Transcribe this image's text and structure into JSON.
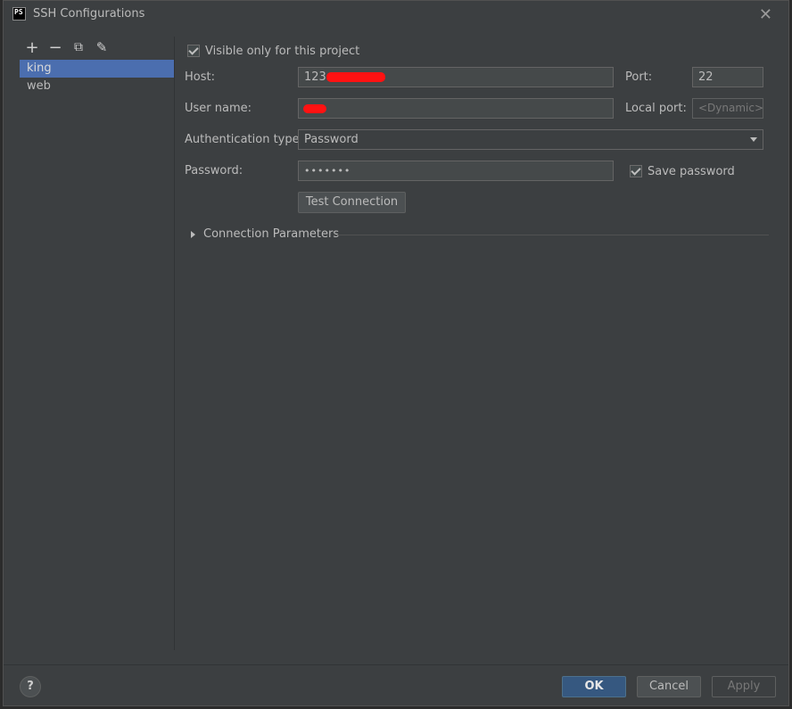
{
  "window": {
    "title": "SSH Configurations",
    "app_icon_text": "PS"
  },
  "toolbar": {
    "add": "+",
    "remove": "−",
    "copy": "⧉",
    "edit": "✎"
  },
  "configs": [
    {
      "label": "king",
      "selected": true
    },
    {
      "label": "web",
      "selected": false
    }
  ],
  "form": {
    "visible_only_label": "Visible only for this project",
    "visible_only_checked": true,
    "host_label": "Host:",
    "host_value": "123.",
    "port_label": "Port:",
    "port_value": "22",
    "username_label": "User name:",
    "username_value": "",
    "local_port_label": "Local port:",
    "local_port_placeholder": "<Dynamic>",
    "auth_label": "Authentication type:",
    "auth_value": "Password",
    "password_label": "Password:",
    "password_value": "•••••••",
    "save_password_label": "Save password",
    "save_password_checked": true,
    "test_connection_label": "Test Connection",
    "connection_params_label": "Connection Parameters"
  },
  "footer": {
    "help": "?",
    "ok": "OK",
    "cancel": "Cancel",
    "apply": "Apply"
  }
}
